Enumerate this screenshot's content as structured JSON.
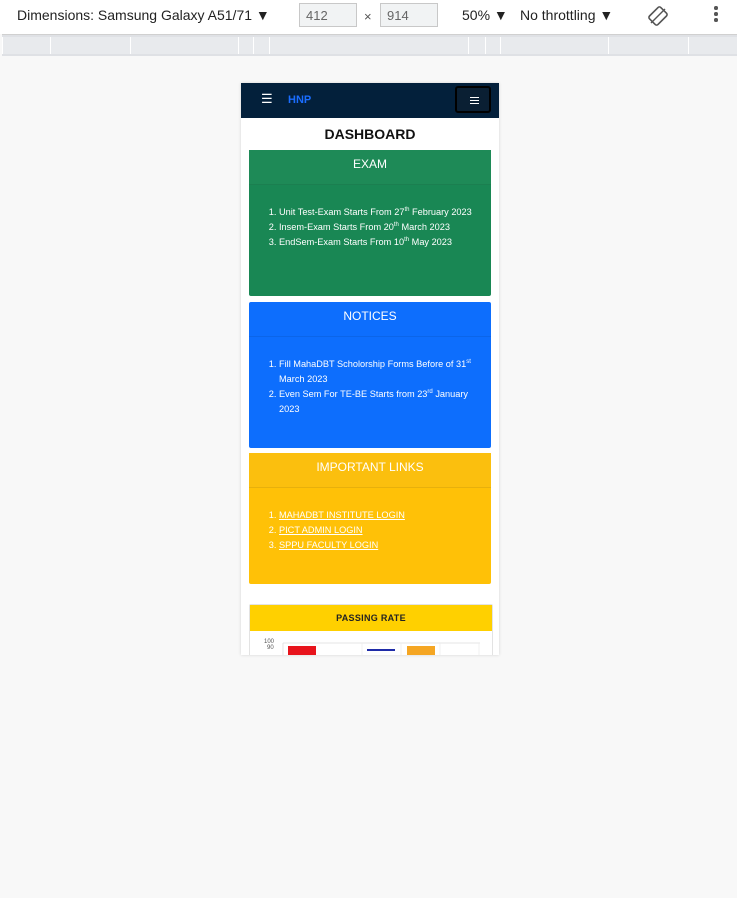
{
  "devtools": {
    "dimensions_label": "Dimensions: Samsung Galaxy A51/71 ▼",
    "width": "412",
    "height": "914",
    "times": "×",
    "zoom": "50% ▼",
    "throttling": "No throttling ▼"
  },
  "navbar": {
    "menu_glyph": "☰",
    "brand": "HNP"
  },
  "page": {
    "title": "DASHBOARD"
  },
  "exam": {
    "title": "EXAM",
    "items": [
      {
        "pre": "Unit Test-Exam Starts From 27",
        "sup": "th",
        "post": " February 2023"
      },
      {
        "pre": "Insem-Exam Starts From 20",
        "sup": "th",
        "post": " March 2023"
      },
      {
        "pre": "EndSem-Exam Starts From 10",
        "sup": "th",
        "post": " May 2023"
      }
    ]
  },
  "notices": {
    "title": "NOTICES",
    "items": [
      {
        "pre": "Fill MahaDBT Scholorship Forms Before of 31",
        "sup": "st",
        "post": " March 2023"
      },
      {
        "pre": "Even Sem For TE-BE Starts from 23",
        "sup": "rd",
        "post": " January 2023"
      }
    ]
  },
  "links": {
    "title": "IMPORTANT LINKS",
    "items": [
      "MAHADBT INSTITUTE LOGIN",
      "PICT ADMIN LOGIN",
      "SPPU FACULTY LOGIN"
    ]
  },
  "passing": {
    "title": "PASSING RATE",
    "tick_labels": [
      "100",
      "90"
    ],
    "bar_colors": [
      "#e8141c",
      "#ffffff",
      "#1f2ca8",
      "#f5a623",
      "#ffffff"
    ]
  }
}
